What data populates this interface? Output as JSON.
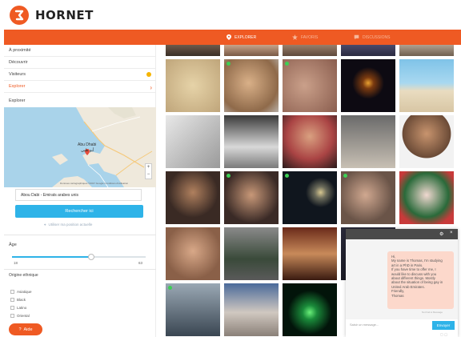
{
  "brand": {
    "name": "HORNET",
    "accent": "#ef5a23"
  },
  "nav": [
    {
      "label": "EXPLORER",
      "icon": "location-pin-icon",
      "active": true
    },
    {
      "label": "FAVORIS",
      "icon": "star-icon",
      "active": false
    },
    {
      "label": "DISCUSSIONS",
      "icon": "chat-icon",
      "active": false
    }
  ],
  "sidebar": {
    "items": [
      {
        "label": "À proximité"
      },
      {
        "label": "Découvrir"
      },
      {
        "label": "Visiteurs",
        "indicator": "notification-dot"
      },
      {
        "label": "Explorer",
        "indicator": "chevron-right-icon",
        "active": true
      }
    ],
    "explorer_title": "Explorer",
    "map": {
      "city_labels": [
        "Abu Dhabi",
        "أبو ظبي"
      ],
      "attribution": "Données cartographiques ©2017 Google   Conditions d'utilisation"
    },
    "location_value": "Abou Dabi - Émirats arabes unis",
    "search_button": "Rechercher ici",
    "use_position": "Utiliser ma position actuelle",
    "age": {
      "title": "Âge",
      "min": "18",
      "max": "63"
    },
    "ethnic": {
      "title": "Origine ethnique",
      "options": [
        "Asiatique",
        "Black",
        "Latino",
        "Oriental"
      ]
    },
    "help_button": "Aide"
  },
  "grid": {
    "online_color": "#3ecf55"
  },
  "chat": {
    "message_lines": [
      "Hi,",
      "My name is Thomas, I'm studying",
      "art in a PhD in Paris.",
      "If you have time to offer me, I",
      "would like to discuss with you",
      "about different things. Mostly",
      "about the situation of being gay in",
      "United Arab Emirates.",
      "Friendly,",
      "Thomas"
    ],
    "meta": "Not Fait à Message",
    "input_placeholder": "Saisir un message...",
    "send_button": "Envoyer"
  }
}
